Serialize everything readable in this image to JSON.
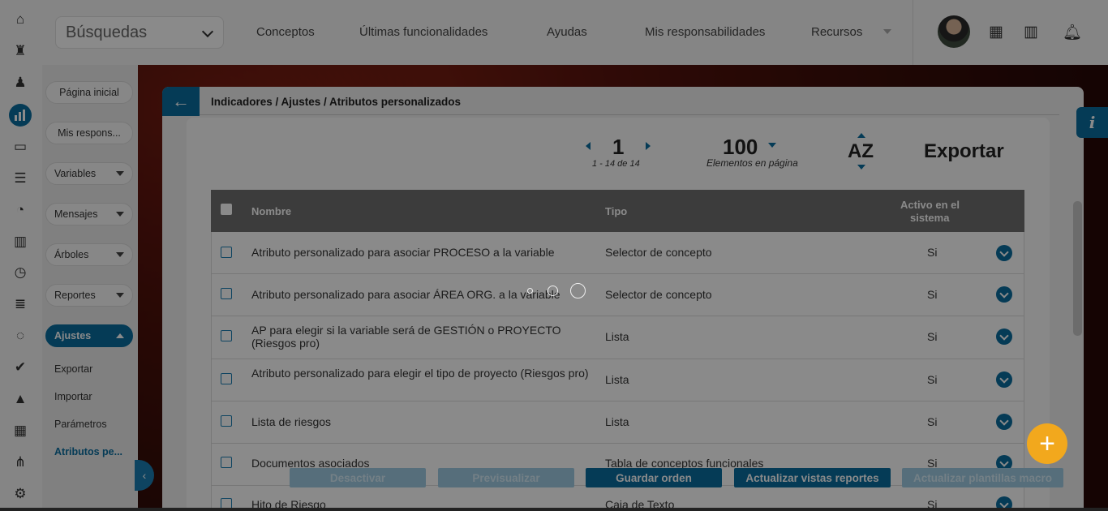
{
  "rail_icons": [
    "home-icon",
    "rook-icon",
    "pawn-icon",
    "bar-chart-icon",
    "monitor-icon",
    "gantt-icon",
    "pie-chart-icon",
    "book-icon",
    "clock-icon",
    "database-icon",
    "cycle-icon",
    "check-icon",
    "warning-icon",
    "calendar-icon",
    "network-icon",
    "settings-icon"
  ],
  "sidebar": {
    "home": "Página inicial",
    "responsibilities": "Mis respons...",
    "items": [
      {
        "label": "Variables"
      },
      {
        "label": "Mensajes"
      },
      {
        "label": "Árboles"
      },
      {
        "label": "Reportes"
      },
      {
        "label": "Ajustes"
      }
    ],
    "sub_items": [
      "Exportar",
      "Importar",
      "Parámetros",
      "Atributos pe..."
    ]
  },
  "topbar": {
    "search_label": "Búsquedas",
    "nav": [
      "Conceptos",
      "Últimas funcionalidades",
      "Ayudas",
      "Mis responsabilidades",
      "Recursos"
    ]
  },
  "breadcrumb": "Indicadores / Ajustes / Atributos personalizados",
  "pagination": {
    "page": "1",
    "range": "1 - 14 de 14",
    "per_page": "100",
    "per_page_label": "Elementos en página",
    "sort": "AZ",
    "export": "Exportar"
  },
  "table": {
    "headers": {
      "name": "Nombre",
      "type": "Tipo",
      "active_1": "Activo en el",
      "active_2": "sistema"
    },
    "rows": [
      {
        "name": "Atributo personalizado para asociar PROCESO a la variable",
        "type": "Selector de concepto",
        "active": "Si"
      },
      {
        "name": "Atributo personalizado para asociar ÁREA ORG. a la variable",
        "type": "Selector de concepto",
        "active": "Si"
      },
      {
        "name": "AP para elegir si la variable será de GESTIÓN o PROYECTO (Riesgos pro)",
        "type": "Lista",
        "active": "Si"
      },
      {
        "name": "Atributo personalizado para elegir el tipo de proyecto (Riesgos pro)",
        "type": "Lista",
        "active": "Si"
      },
      {
        "name": "Lista de riesgos",
        "type": "Lista",
        "active": "Si"
      },
      {
        "name": "Documentos asociados",
        "type": "Tabla de conceptos funcionales",
        "active": "Si"
      },
      {
        "name": "Hito de Riesgo",
        "type": "Caja de Texto",
        "active": "Si"
      }
    ]
  },
  "actions": {
    "deactivate": "Desactivar",
    "preview": "Previsualizar",
    "save_order": "Guardar orden",
    "update_views": "Actualizar vistas reportes",
    "update_templates": "Actualizar plantillas macro"
  },
  "fab_label": "+",
  "info_label": "i",
  "colors": {
    "accent": "#0a6ea0",
    "fab": "#f2a81d",
    "header": "#707070"
  }
}
